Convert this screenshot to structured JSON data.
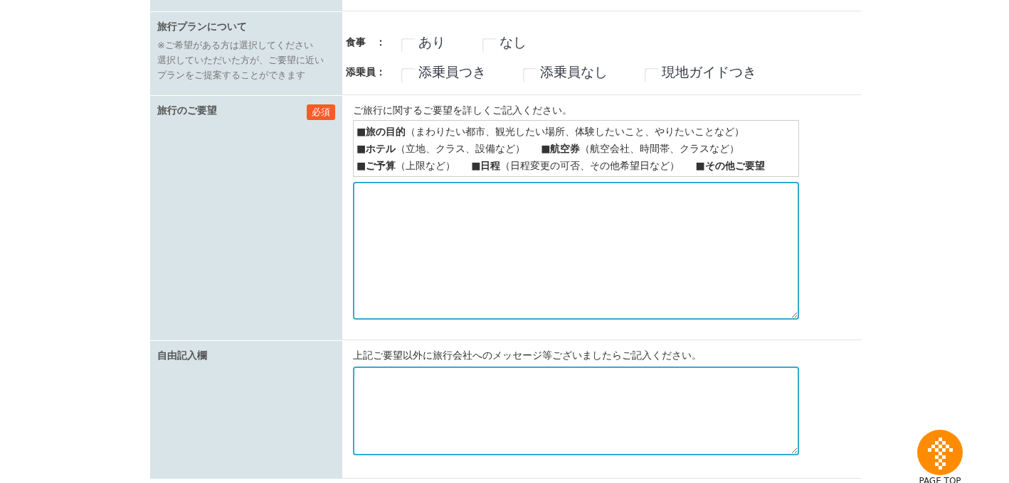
{
  "plan_section": {
    "label": "旅行プランについて",
    "hint_lines": [
      "※ご希望がある方は選択してください",
      "選択していただいた方が、ご要望に近いプランをご提案することができます"
    ],
    "groups": [
      {
        "label": "食事　：",
        "options": [
          {
            "label": "あり",
            "checked": false
          },
          {
            "label": "なし",
            "checked": false
          }
        ]
      },
      {
        "label": "添乗員：",
        "options": [
          {
            "label": "添乗員つき",
            "checked": false
          },
          {
            "label": "添乗員なし",
            "checked": false
          },
          {
            "label": "現地ガイドつき",
            "checked": false
          }
        ]
      }
    ]
  },
  "request_section": {
    "label": "旅行のご要望",
    "required_badge": "必須",
    "instruction": "ご旅行に関するご要望を詳しくご記入ください。",
    "guide_lines": [
      [
        "■**旅の目的**（まわりたい都市、観光したい場所、体験したいこと、やりたいことなど）"
      ],
      [
        "■**ホテル**（立地、クラス、設備など）",
        "■**航空券**（航空会社、時間帯、クラスなど）"
      ],
      [
        "■**ご予算**（上限など）",
        "■**日程**（日程変更の可否、その他希望日など）",
        "■**その他ご要望**"
      ]
    ]
  },
  "free_section": {
    "label": "自由記入欄",
    "instruction": "上記ご要望以外に旅行会社へのメッセージ等ございましたらご記入ください。"
  },
  "page_top": {
    "label": "PAGE TOP"
  }
}
